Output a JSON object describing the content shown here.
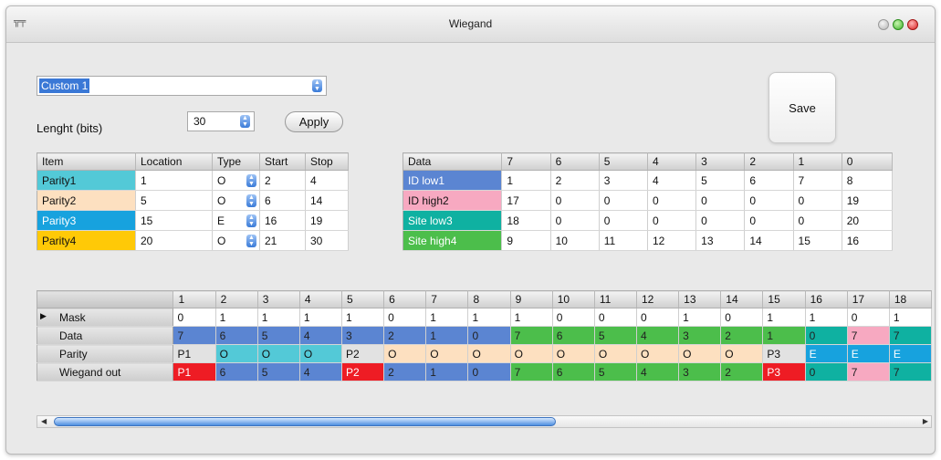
{
  "window": {
    "title": "Wiegand",
    "icon": "connector-icon"
  },
  "preset": {
    "value": "Custom 1"
  },
  "length": {
    "label": "Lenght (bits)",
    "value": "30"
  },
  "buttons": {
    "apply": "Apply",
    "save": "Save"
  },
  "colors": {
    "parity1": "#53c9d7",
    "parity2": "#fde0c0",
    "parity3": "#17a2de",
    "parity4": "#ffc907",
    "id_low": "#5b85d2",
    "id_high": "#f7a9c1",
    "site_low": "#0fb1a1",
    "site_high": "#4cbe4b",
    "p_red": "#ee1c24"
  },
  "items_table": {
    "headers": [
      "Item",
      "Location",
      "Type",
      "Start",
      "Stop"
    ],
    "rows": [
      [
        "Parity1",
        "1",
        "O",
        "2",
        "4"
      ],
      [
        "Parity2",
        "5",
        "O",
        "6",
        "14"
      ],
      [
        "Parity3",
        "15",
        "E",
        "16",
        "19"
      ],
      [
        "Parity4",
        "20",
        "O",
        "21",
        "30"
      ]
    ]
  },
  "data_table": {
    "headers": [
      "Data",
      "7",
      "6",
      "5",
      "4",
      "3",
      "2",
      "1",
      "0"
    ],
    "rows": [
      [
        "ID low1",
        "1",
        "2",
        "3",
        "4",
        "5",
        "6",
        "7",
        "8"
      ],
      [
        "ID high2",
        "17",
        "0",
        "0",
        "0",
        "0",
        "0",
        "0",
        "19"
      ],
      [
        "Site low3",
        "18",
        "0",
        "0",
        "0",
        "0",
        "0",
        "0",
        "20"
      ],
      [
        "Site high4",
        "9",
        "10",
        "11",
        "12",
        "13",
        "14",
        "15",
        "16"
      ]
    ]
  },
  "wiegand_table": {
    "columns": [
      "1",
      "2",
      "3",
      "4",
      "5",
      "6",
      "7",
      "8",
      "9",
      "10",
      "11",
      "12",
      "13",
      "14",
      "15",
      "16",
      "17",
      "18"
    ],
    "rows": [
      {
        "label": "Mask",
        "cells": [
          "0",
          "1",
          "1",
          "1",
          "1",
          "0",
          "1",
          "1",
          "1",
          "0",
          "0",
          "0",
          "1",
          "0",
          "1",
          "1",
          "0",
          "1"
        ]
      },
      {
        "label": "Data",
        "cells": [
          "7",
          "6",
          "5",
          "4",
          "3",
          "2",
          "1",
          "0",
          "7",
          "6",
          "5",
          "4",
          "3",
          "2",
          "1",
          "0",
          "7",
          "7"
        ]
      },
      {
        "label": "Parity",
        "cells": [
          "P1",
          "O",
          "O",
          "O",
          "P2",
          "O",
          "O",
          "O",
          "O",
          "O",
          "O",
          "O",
          "O",
          "O",
          "P3",
          "E",
          "E",
          "E"
        ]
      },
      {
        "label": "Wiegand out",
        "cells": [
          "P1",
          "6",
          "5",
          "4",
          "P2",
          "2",
          "1",
          "0",
          "7",
          "6",
          "5",
          "4",
          "3",
          "2",
          "P3",
          "0",
          "7",
          "7"
        ]
      }
    ]
  }
}
